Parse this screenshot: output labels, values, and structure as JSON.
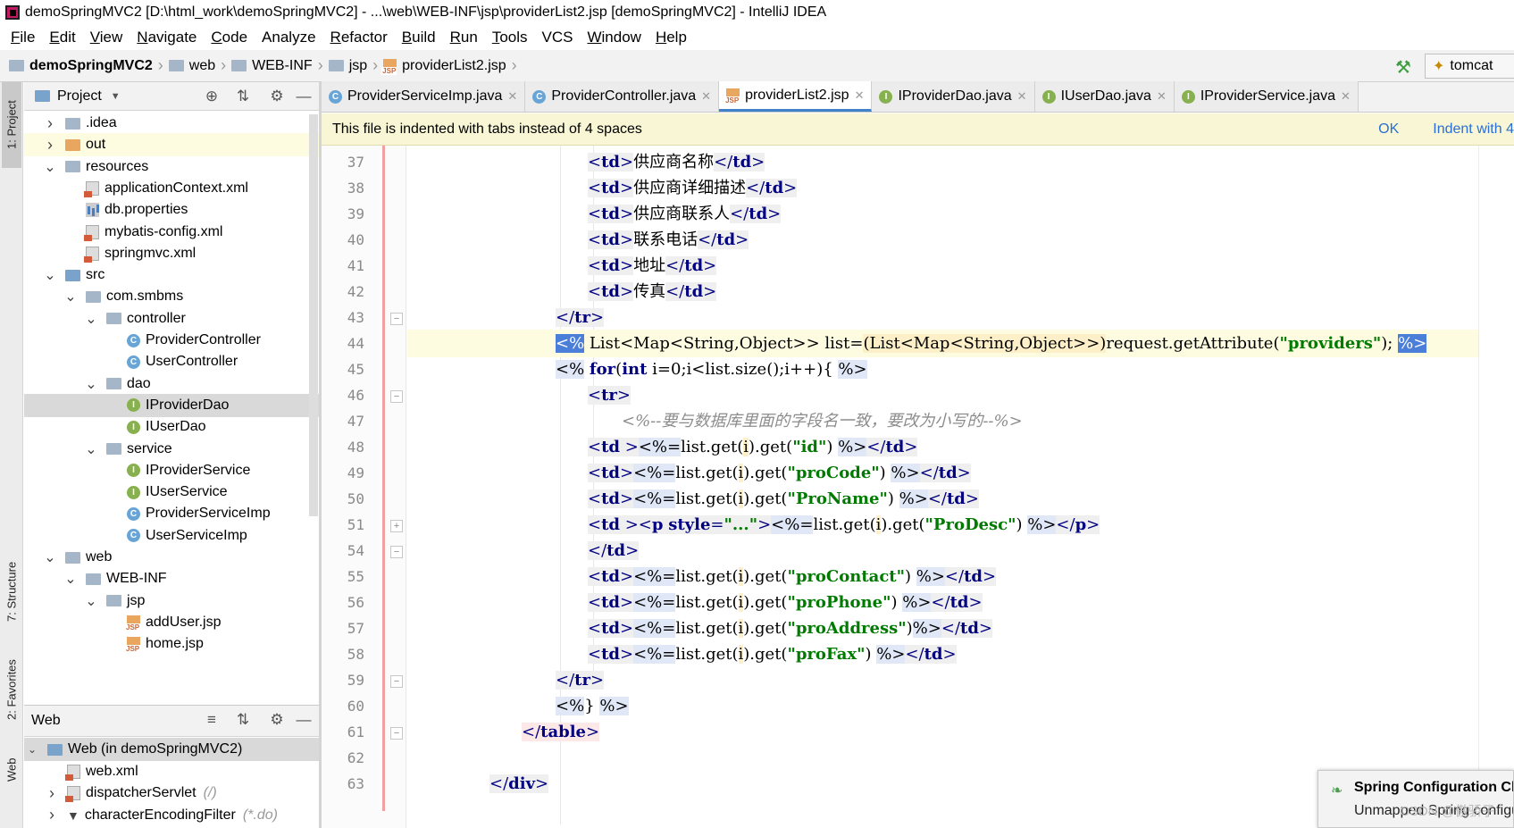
{
  "window": {
    "title": "demoSpringMVC2 [D:\\html_work\\demoSpringMVC2] - ...\\web\\WEB-INF\\jsp\\providerList2.jsp [demoSpringMVC2] - IntelliJ IDEA"
  },
  "menu": [
    {
      "u": "F",
      "rest": "ile"
    },
    {
      "u": "E",
      "rest": "dit"
    },
    {
      "u": "V",
      "rest": "iew"
    },
    {
      "u": "N",
      "rest": "avigate"
    },
    {
      "u": "C",
      "rest": "ode"
    },
    {
      "u": "",
      "rest": "Analyze"
    },
    {
      "u": "R",
      "rest": "efactor"
    },
    {
      "u": "B",
      "rest": "uild"
    },
    {
      "u": "R",
      "rest": "un"
    },
    {
      "u": "T",
      "rest": "ools"
    },
    {
      "u": "",
      "rest": "VCS"
    },
    {
      "u": "W",
      "rest": "indow"
    },
    {
      "u": "H",
      "rest": "elp"
    }
  ],
  "breadcrumbs": [
    "demoSpringMVC2",
    "web",
    "WEB-INF",
    "jsp",
    "providerList2.jsp"
  ],
  "run_config": "tomcat",
  "left_tools": [
    "1: Project",
    "7: Structure",
    "2: Favorites",
    "Web"
  ],
  "project": {
    "header": "Project",
    "tree": [
      {
        "label": ".idea",
        "icon": "folder",
        "arrow": "right"
      },
      {
        "label": "out",
        "icon": "folder-orange",
        "arrow": "right"
      },
      {
        "label": "resources",
        "icon": "folder",
        "arrow": "down"
      },
      {
        "label": "applicationContext.xml",
        "icon": "xml"
      },
      {
        "label": "db.properties",
        "icon": "properties"
      },
      {
        "label": "mybatis-config.xml",
        "icon": "xml"
      },
      {
        "label": "springmvc.xml",
        "icon": "xml"
      },
      {
        "label": "src",
        "icon": "folder-blue",
        "arrow": "down"
      },
      {
        "label": "com.smbms",
        "icon": "package",
        "arrow": "down"
      },
      {
        "label": "controller",
        "icon": "package",
        "arrow": "down"
      },
      {
        "label": "ProviderController",
        "icon": "class"
      },
      {
        "label": "UserController",
        "icon": "class"
      },
      {
        "label": "dao",
        "icon": "package",
        "arrow": "down"
      },
      {
        "label": "IProviderDao",
        "icon": "interface"
      },
      {
        "label": "IUserDao",
        "icon": "interface"
      },
      {
        "label": "service",
        "icon": "package",
        "arrow": "down"
      },
      {
        "label": "IProviderService",
        "icon": "interface"
      },
      {
        "label": "IUserService",
        "icon": "interface"
      },
      {
        "label": "ProviderServiceImp",
        "icon": "class"
      },
      {
        "label": "UserServiceImp",
        "icon": "class"
      },
      {
        "label": "web",
        "icon": "folder",
        "arrow": "down"
      },
      {
        "label": "WEB-INF",
        "icon": "folder",
        "arrow": "down"
      },
      {
        "label": "jsp",
        "icon": "folder",
        "arrow": "down"
      },
      {
        "label": "addUser.jsp",
        "icon": "jsp"
      },
      {
        "label": "home.jsp",
        "icon": "jsp"
      }
    ]
  },
  "web_panel": {
    "header": "Web",
    "tree": [
      {
        "label": "Web (in demoSpringMVC2)",
        "icon": "web-module",
        "arrow": "down",
        "note": ""
      },
      {
        "label": "web.xml",
        "icon": "xml",
        "note": ""
      },
      {
        "label": "dispatcherServlet",
        "icon": "servlet",
        "arrow": "right",
        "note": "(/)"
      },
      {
        "label": "characterEncodingFilter",
        "icon": "filter",
        "arrow": "right",
        "note": "(*.do)"
      }
    ]
  },
  "tabs": [
    {
      "label": "ProviderServiceImp.java",
      "icon": "class",
      "active": false
    },
    {
      "label": "ProviderController.java",
      "icon": "class",
      "active": false
    },
    {
      "label": "providerList2.jsp",
      "icon": "jsp",
      "active": true
    },
    {
      "label": "IProviderDao.java",
      "icon": "interface",
      "active": false
    },
    {
      "label": "IUserDao.java",
      "icon": "interface",
      "active": false
    },
    {
      "label": "IProviderService.java",
      "icon": "interface",
      "active": false
    }
  ],
  "notice": {
    "text": "This file is indented with tabs instead of 4 spaces",
    "ok": "OK",
    "indent": "Indent with 4"
  },
  "line_numbers": [
    "37",
    "38",
    "39",
    "40",
    "41",
    "42",
    "43",
    "44",
    "45",
    "46",
    "47",
    "48",
    "49",
    "50",
    "51",
    "54",
    "55",
    "56",
    "57",
    "58",
    "59",
    "60",
    "61",
    "62",
    "63"
  ],
  "code": {
    "l37": "供应商名称",
    "l38": "供应商详细描述",
    "l39": "供应商联系人",
    "l40": "联系电话",
    "l41": "地址",
    "l42": "传真",
    "l44_a": " List<Map<String,Object>> list=",
    "l44_b": "(List<Map<String,Object>>)",
    "l44_c": "request.getAttribute(",
    "l44_d": "\"providers\"",
    "l44_e": "); ",
    "l45_a": "for",
    "l45_b": "(",
    "l45_c": "int",
    "l45_d": " i=0;i<list.size();i++){ ",
    "l47": "<%--要与数据库里面的字段名一致，要改为小写的--%>",
    "l48_str": "\"id\"",
    "l49_str": "\"proCode\"",
    "l50_str": "\"ProName\"",
    "l51_style": "\"...\"",
    "l51_str": "\"ProDesc\"",
    "l55_str": "\"proContact\"",
    "l56_str": "\"proPhone\"",
    "l57_str": "\"proAddress\"",
    "l58_str": "\"proFax\""
  },
  "popup": {
    "title": "Spring Configuration Check",
    "subtitle": "Unmapped Spring configuration"
  },
  "watermark": "CSDN @傲骄子"
}
